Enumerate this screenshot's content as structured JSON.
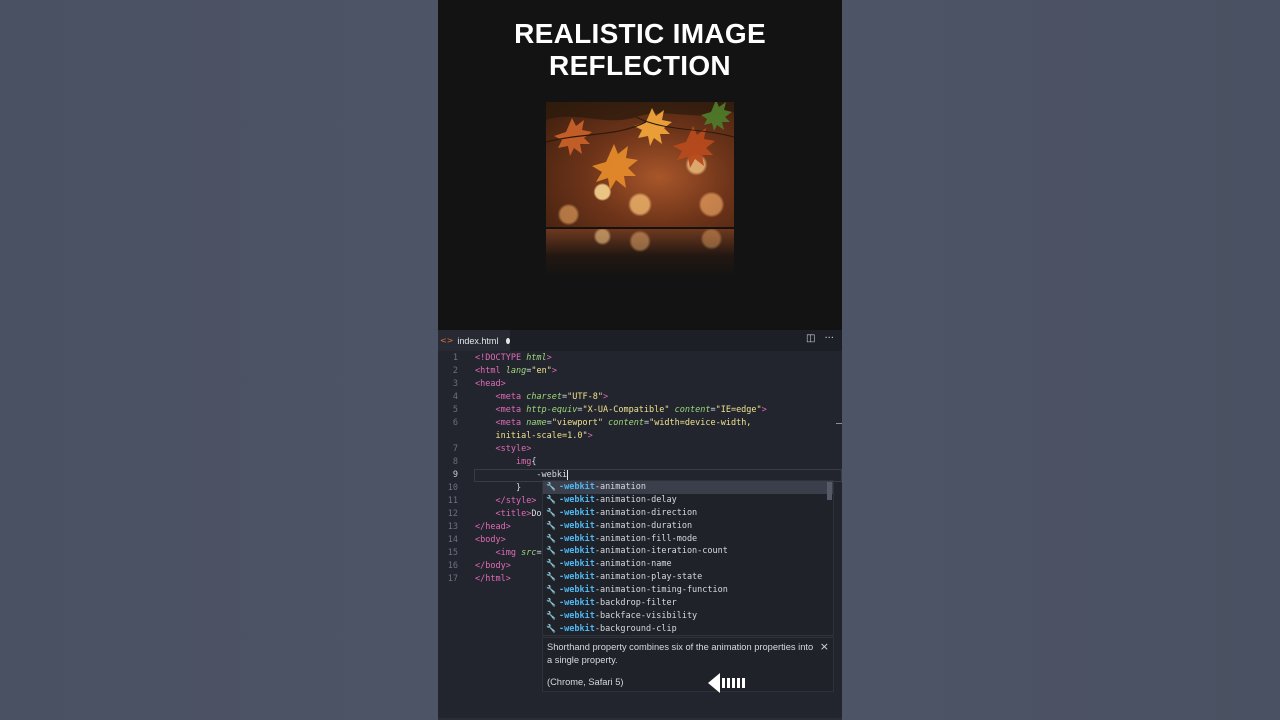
{
  "video": {
    "title_lines": [
      "REALISTIC IMAGE",
      "REFLECTION"
    ]
  },
  "editor": {
    "tab": {
      "filename": "index.html",
      "icon": "html-file-icon",
      "modified": true
    },
    "actions": [
      {
        "name": "split-editor-icon",
        "glyph": "◫"
      },
      {
        "name": "more-actions-icon",
        "glyph": "···"
      }
    ],
    "active_line": 9,
    "lines": [
      {
        "n": "1",
        "tokens": [
          [
            "tag",
            "<!DOCTYPE "
          ],
          [
            "attr",
            "html"
          ],
          [
            "tag",
            ">"
          ]
        ]
      },
      {
        "n": "2",
        "tokens": [
          [
            "tag",
            "<html "
          ],
          [
            "attr",
            "lang"
          ],
          [
            "pl",
            "="
          ],
          [
            "str",
            "\"en\""
          ],
          [
            "tag",
            ">"
          ]
        ]
      },
      {
        "n": "3",
        "tokens": [
          [
            "tag",
            "<head>"
          ]
        ]
      },
      {
        "n": "4",
        "tokens": [
          [
            "pl",
            "    "
          ],
          [
            "tag",
            "<meta "
          ],
          [
            "attr",
            "charset"
          ],
          [
            "pl",
            "="
          ],
          [
            "str",
            "\"UTF-8\""
          ],
          [
            "tag",
            ">"
          ]
        ]
      },
      {
        "n": "5",
        "tokens": [
          [
            "pl",
            "    "
          ],
          [
            "tag",
            "<meta "
          ],
          [
            "attr",
            "http-equiv"
          ],
          [
            "pl",
            "="
          ],
          [
            "str",
            "\"X-UA-Compatible\""
          ],
          [
            "pl",
            " "
          ],
          [
            "attr",
            "content"
          ],
          [
            "pl",
            "="
          ],
          [
            "str",
            "\"IE=edge\""
          ],
          [
            "tag",
            ">"
          ]
        ]
      },
      {
        "n": "6",
        "tokens": [
          [
            "pl",
            "    "
          ],
          [
            "tag",
            "<meta "
          ],
          [
            "attr",
            "name"
          ],
          [
            "pl",
            "="
          ],
          [
            "str",
            "\"viewport\""
          ],
          [
            "pl",
            " "
          ],
          [
            "attr",
            "content"
          ],
          [
            "pl",
            "="
          ],
          [
            "str",
            "\"width=device-width,"
          ]
        ]
      },
      {
        "n": "",
        "tokens": [
          [
            "pl",
            "    "
          ],
          [
            "str",
            "initial-scale=1.0\""
          ],
          [
            "tag",
            ">"
          ]
        ]
      },
      {
        "n": "7",
        "tokens": [
          [
            "pl",
            "    "
          ],
          [
            "tag",
            "<style>"
          ]
        ]
      },
      {
        "n": "8",
        "tokens": [
          [
            "pl",
            "        "
          ],
          [
            "kw",
            "img"
          ],
          [
            "pl",
            "{"
          ]
        ]
      },
      {
        "n": "9",
        "tokens": [
          [
            "pl",
            "            -webki"
          ]
        ],
        "caret": true
      },
      {
        "n": "10",
        "tokens": [
          [
            "pl",
            "        }"
          ]
        ]
      },
      {
        "n": "11",
        "tokens": [
          [
            "pl",
            "    "
          ],
          [
            "tag",
            "</style>"
          ]
        ]
      },
      {
        "n": "12",
        "tokens": [
          [
            "pl",
            "    "
          ],
          [
            "tag",
            "<title>"
          ],
          [
            "pl",
            "Do"
          ]
        ]
      },
      {
        "n": "13",
        "tokens": [
          [
            "tag",
            "</head>"
          ]
        ]
      },
      {
        "n": "14",
        "tokens": [
          [
            "tag",
            "<body>"
          ]
        ]
      },
      {
        "n": "15",
        "tokens": [
          [
            "pl",
            "    "
          ],
          [
            "tag",
            "<img "
          ],
          [
            "attr",
            "src"
          ],
          [
            "pl",
            "="
          ]
        ]
      },
      {
        "n": "16",
        "tokens": [
          [
            "tag",
            "</body>"
          ]
        ]
      },
      {
        "n": "17",
        "tokens": [
          [
            "tag",
            "</html>"
          ]
        ]
      }
    ],
    "suggestions": {
      "match_prefix": "-webkit",
      "selected_index": 0,
      "items": [
        "-webkit-animation",
        "-webkit-animation-delay",
        "-webkit-animation-direction",
        "-webkit-animation-duration",
        "-webkit-animation-fill-mode",
        "-webkit-animation-iteration-count",
        "-webkit-animation-name",
        "-webkit-animation-play-state",
        "-webkit-animation-timing-function",
        "-webkit-backdrop-filter",
        "-webkit-backface-visibility",
        "-webkit-background-clip"
      ]
    },
    "details": {
      "description": "Shorthand property combines six of the animation properties into a single property.",
      "compat": "(Chrome, Safari 5)",
      "close_glyph": "×"
    }
  }
}
